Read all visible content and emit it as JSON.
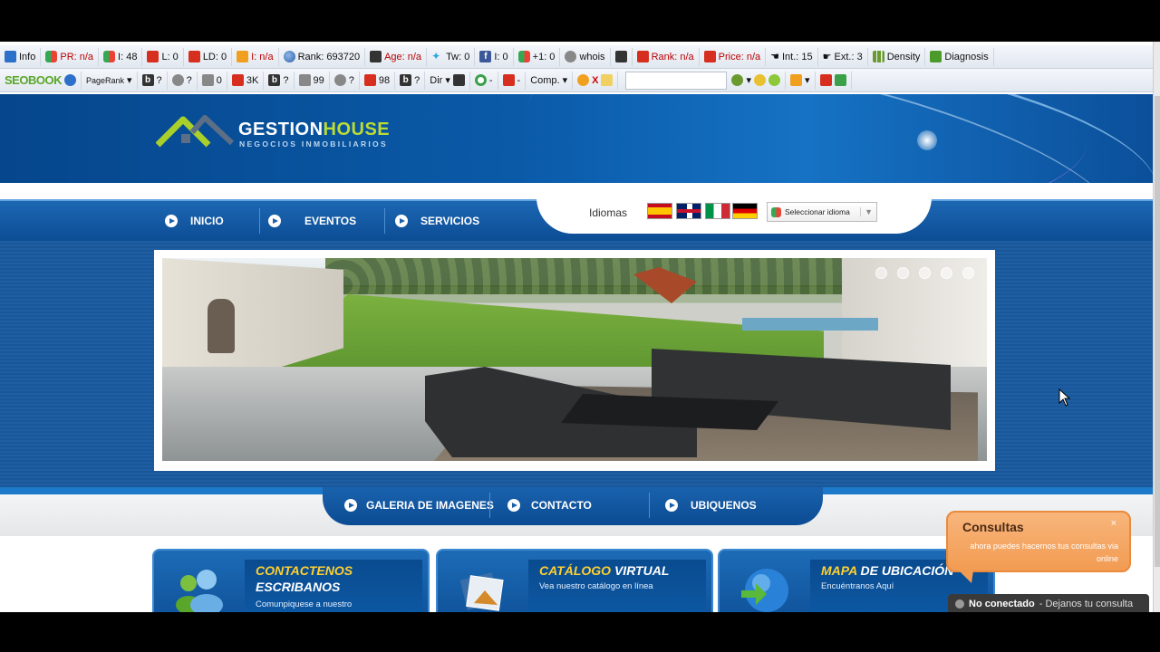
{
  "toolbar1": {
    "info": "Info",
    "pr": "PR: n/a",
    "indexed": "I: 48",
    "links": "L: 0",
    "ld": "LD: 0",
    "bing_index": "I: n/a",
    "rank": "Rank: 693720",
    "age": "Age: n/a",
    "twitter": "Tw: 0",
    "facebook": "I: 0",
    "gplus": "+1: 0",
    "whois": "whois",
    "semrush_rank": "Rank: n/a",
    "price": "Price: n/a",
    "internal": "Int.: 15",
    "external": "Ext.: 3",
    "density": "Density",
    "diagnosis": "Diagnosis"
  },
  "toolbar2": {
    "seobook": "SEOBOOK",
    "pagerank": "PageRank",
    "q1": "?",
    "q2": "?",
    "zero": "0",
    "seo_3k": "3K",
    "q3": "?",
    "v99": "99",
    "q4": "?",
    "v98": "98",
    "q5": "?",
    "dir": "Dir",
    "dash1": "-",
    "dash2": "-",
    "comp": "Comp.",
    "search_value": ""
  },
  "site": {
    "logo_main": "GESTION",
    "logo_accent": "HOUSE",
    "logo_sub": "NEGOCIOS INMOBILIARIOS",
    "nav": [
      "INICIO",
      "EVENTOS",
      "SERVICIOS"
    ],
    "idiomas": "Idiomas",
    "lang_select": "Seleccionar idioma",
    "bottom_nav": [
      "GALERIA DE IMAGENES",
      "CONTACTO",
      "UBIQUENOS"
    ],
    "cards": [
      {
        "title_a": "CONTACTENOS",
        "title_b": "ESCRIBANOS",
        "sub": "Comunpiquese a nuestro"
      },
      {
        "title_a": "CATÁLOGO",
        "title_b": " VIRTUAL",
        "sub": "Vea nuestro catálogo en línea"
      },
      {
        "title_a": "MAPA",
        "title_b": " DE UBICACIÓN",
        "sub": "Encuéntranos Aquí"
      }
    ]
  },
  "chat": {
    "title": "Consultas",
    "close": "×",
    "text": "ahora puedes hacernos tus consultas via online",
    "status_bold": "No conectado",
    "status_rest": " - Dejanos tu consulta"
  },
  "colors": {
    "brand_blue": "#0c4d95",
    "accent_lime": "#bcdc33",
    "card_title_yellow": "#ffd030",
    "chat_orange": "#f29b52"
  }
}
